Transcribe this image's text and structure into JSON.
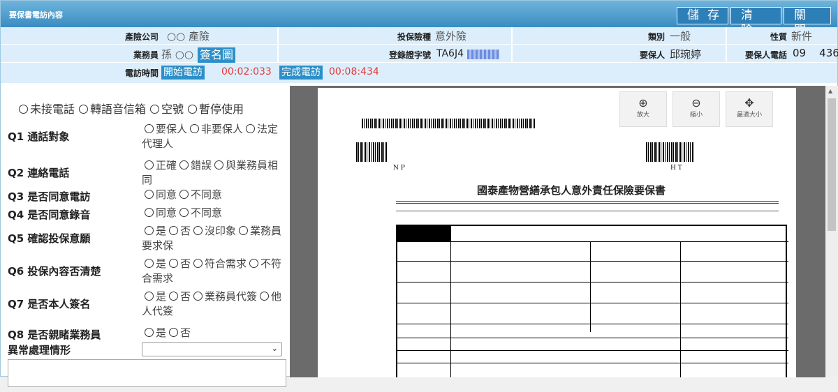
{
  "title": "要保書電訪內容",
  "toolbar": {
    "save": "儲存",
    "clear": "清除",
    "close": "關閉"
  },
  "info": {
    "insurer_label": "產險公司",
    "insurer_value": "○○ 產險",
    "type_label": "投保險種",
    "type_value": "意外險",
    "category_label": "類別",
    "category_value": "一般",
    "nature_label": "性質",
    "nature_value": "新件",
    "agent_label": "業務員",
    "agent_value": "孫 ○○",
    "sign_btn": "簽名圖",
    "reg_label": "登錄證字號",
    "reg_value": "TA6J4",
    "applicant_label": "要保人",
    "applicant_value": "邱琬婷",
    "phone_label": "要保人電話",
    "phone_value": "09    436",
    "time_label": "電訪時間",
    "start_btn": "開始電訪",
    "start_time": "00:02:033",
    "end_btn": "完成電訪",
    "end_time": "00:08:434"
  },
  "status_options": [
    "未接電話",
    "轉語音信箱",
    "空號",
    "暫停使用"
  ],
  "questions": [
    {
      "label": "Q1 通話對象",
      "options": [
        "要保人",
        "非要保人",
        "法定代理人"
      ]
    },
    {
      "label": "Q2 連絡電話",
      "options": [
        "正確",
        "錯誤",
        "與業務員相同"
      ]
    },
    {
      "label": "Q3 是否同意電訪",
      "options": [
        "同意",
        "不同意"
      ]
    },
    {
      "label": "Q4 是否同意錄音",
      "options": [
        "同意",
        "不同意"
      ]
    },
    {
      "label": "Q5 確認投保意願",
      "options": [
        "是",
        "否",
        "沒印象",
        "業務員要求保"
      ]
    },
    {
      "label": "Q6 投保內容否清楚",
      "options": [
        "是",
        "否",
        "符合需求",
        "不符合需求"
      ]
    },
    {
      "label": "Q7 是否本人簽名",
      "options": [
        "是",
        "否",
        "業務員代簽",
        "他人代簽"
      ]
    },
    {
      "label": "Q8 是否親睹業務員",
      "options": [
        "是",
        "否"
      ]
    }
  ],
  "abnormal_label": "異常處理情形",
  "viewer": {
    "zoom_in": "放大",
    "zoom_out": "縮小",
    "fit": "最適大小",
    "zoom_in_icon": "zoom-in-icon",
    "zoom_out_icon": "zoom-out-icon",
    "fit_icon": "move-icon",
    "doc_title": "國泰產物營繕承包人意外責任保險要保書",
    "np": "N P",
    "ht": "H T"
  }
}
